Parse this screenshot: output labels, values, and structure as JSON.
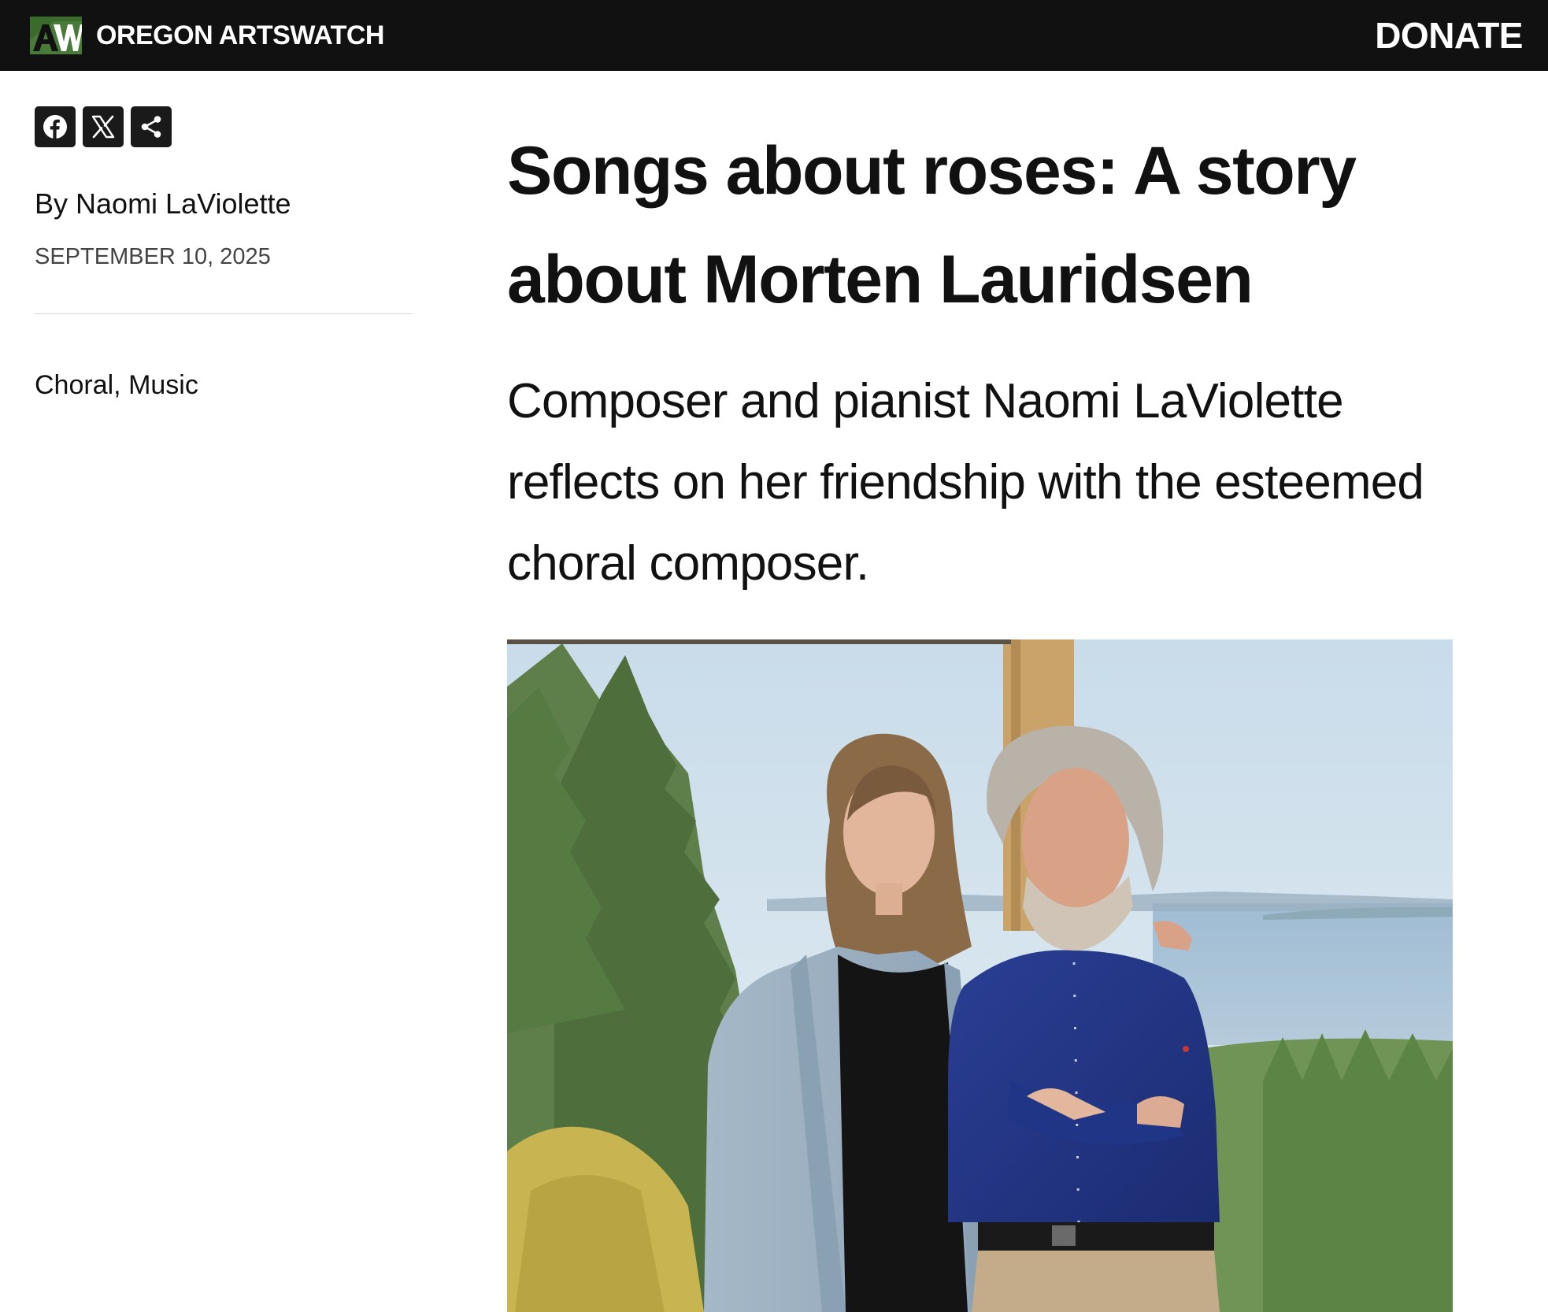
{
  "header": {
    "brand": "OREGON ARTSWATCH",
    "donate_label": "DONATE"
  },
  "share": {
    "facebook_icon": "facebook-icon",
    "x_icon": "x-icon",
    "share_icon": "share-icon"
  },
  "article": {
    "byline_prefix": "By",
    "author": "Naomi LaViolette",
    "date": "SEPTEMBER 10, 2025",
    "categories": [
      "Choral",
      "Music"
    ],
    "category_sep": ", ",
    "title": "Songs about roses: A story about Morten Lauridsen",
    "dek": "Composer and pianist Naomi LaViolette reflects on her friendship with the esteemed choral composer."
  },
  "colors": {
    "topbar": "#111111",
    "logo_green": "#4a7a3a",
    "text": "#111111",
    "meta_gray": "#444444"
  }
}
